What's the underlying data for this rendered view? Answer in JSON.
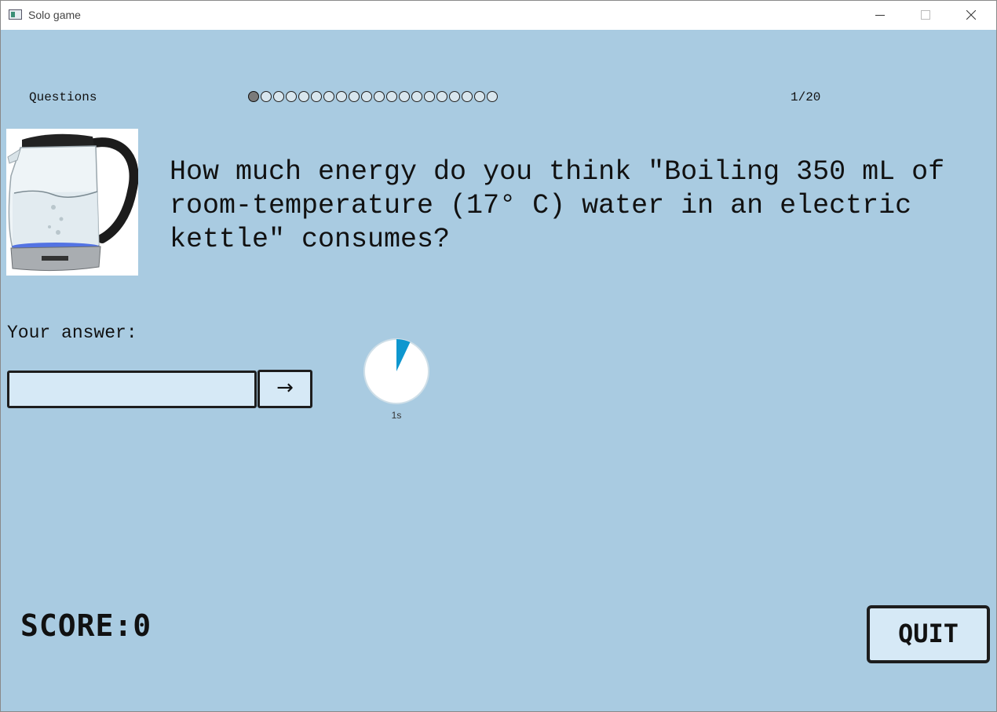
{
  "window": {
    "title": "Solo game"
  },
  "header": {
    "questions_label": "Questions",
    "total_questions": 20,
    "current_index": 1,
    "counter_text": "1/20"
  },
  "question": {
    "text": "How much energy do you think \"Boiling 350 mL of room-temperature (17° C) water in an electric kettle\" consumes?",
    "image_icon": "electric-kettle"
  },
  "answer": {
    "label": "Your answer:",
    "value": "",
    "placeholder": "",
    "submit_label": "→"
  },
  "timer": {
    "elapsed_fraction": 0.07,
    "label": "1s",
    "colors": {
      "face": "#ffffff",
      "fill": "#0e97cf"
    }
  },
  "score": {
    "text": "SCORE:0"
  },
  "quit": {
    "label": "QUIT"
  },
  "colors": {
    "background": "#a9cbe1",
    "button_bg": "#d6e9f6"
  }
}
